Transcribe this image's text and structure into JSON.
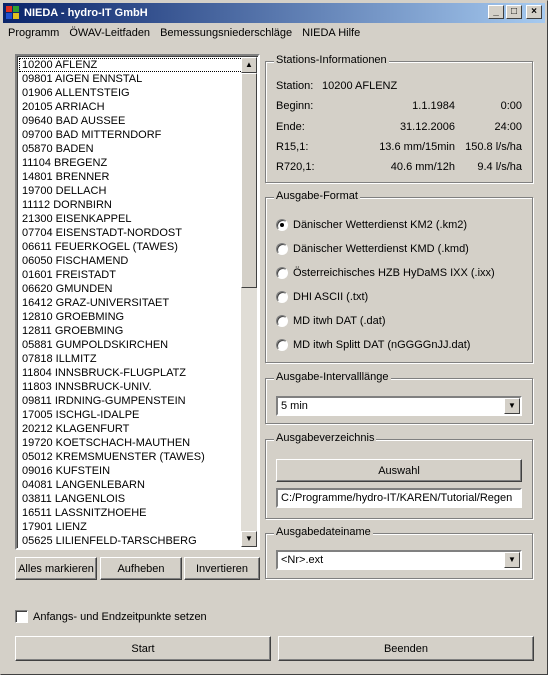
{
  "window": {
    "title": "NIEDA - hydro-IT GmbH",
    "minimize": "_",
    "maximize": "□",
    "close": "×"
  },
  "menu": [
    "Programm",
    "ÖWAV-Leitfaden",
    "Bemessungsniederschläge",
    "NIEDA Hilfe"
  ],
  "stations": [
    "10200 AFLENZ",
    "09801 AIGEN ENNSTAL",
    "01906 ALLENTSTEIG",
    "20105 ARRIACH",
    "09640 BAD AUSSEE",
    "09700 BAD MITTERNDORF",
    "05870 BADEN",
    "11104 BREGENZ",
    "14801 BRENNER",
    "19700 DELLACH",
    "11112 DORNBIRN",
    "21300 EISENKAPPEL",
    "07704 EISENSTADT-NORDOST",
    "06611 FEUERKOGEL (TAWES)",
    "06050 FISCHAMEND",
    "01601 FREISTADT",
    "06620 GMUNDEN",
    "16412 GRAZ-UNIVERSITAET",
    "12810 GROEBMING",
    "12811 GROEBMING",
    "05881 GUMPOLDSKIRCHEN",
    "07818 ILLMITZ",
    "11804 INNSBRUCK-FLUGPLATZ",
    "11803 INNSBRUCK-UNIV.",
    "09811 IRDNING-GUMPENSTEIN",
    "17005 ISCHGL-IDALPE",
    "20212 KLAGENFURT",
    "19720 KOETSCHACH-MAUTHEN",
    "05012 KREMSMUENSTER (TAWES)",
    "09016 KUFSTEIN",
    "04081 LANGENLEBARN",
    "03811 LANGENLOIS",
    "16511 LASSNITZHOEHE",
    "17901 LIENZ",
    "05625 LILIENFELD-TARSCHBERG"
  ],
  "list_buttons": {
    "select_all": "Alles markieren",
    "deselect": "Aufheben",
    "invert": "Invertieren"
  },
  "station_info": {
    "legend": "Stations-Informationen",
    "station_label": "Station:",
    "station_value": "10200 AFLENZ",
    "begin_label": "Beginn:",
    "begin_date": "1.1.1984",
    "begin_time": "0:00",
    "end_label": "Ende:",
    "end_date": "31.12.2006",
    "end_time": "24:00",
    "r15_label": "R15,1:",
    "r15_value": "13.6 mm/15min",
    "r15_rate": "150.8 l/s/ha",
    "r720_label": "R720,1:",
    "r720_value": "40.6 mm/12h",
    "r720_rate": "9.4 l/s/ha"
  },
  "output_format": {
    "legend": "Ausgabe-Format",
    "options": [
      "Dänischer Wetterdienst KM2 (.km2)",
      "Dänischer Wetterdienst KMD (.kmd)",
      "Österreichisches HZB HyDaMS IXX (.ixx)",
      "DHI ASCII (.txt)",
      "MD itwh DAT (.dat)",
      "MD itwh Splitt DAT (nGGGGnJJ.dat)"
    ],
    "selected_index": 0
  },
  "interval": {
    "legend": "Ausgabe-Intervalllänge",
    "value": "5 min"
  },
  "output_dir": {
    "legend": "Ausgabeverzeichnis",
    "button": "Auswahl",
    "path": "C:/Programme/hydro-IT/KAREN/Tutorial/Regen"
  },
  "output_filename": {
    "legend": "Ausgabedateiname",
    "value": "<Nr>.ext"
  },
  "checkbox_label": "Anfangs- und Endzeitpunkte setzen",
  "start_button": "Start",
  "exit_button": "Beenden"
}
